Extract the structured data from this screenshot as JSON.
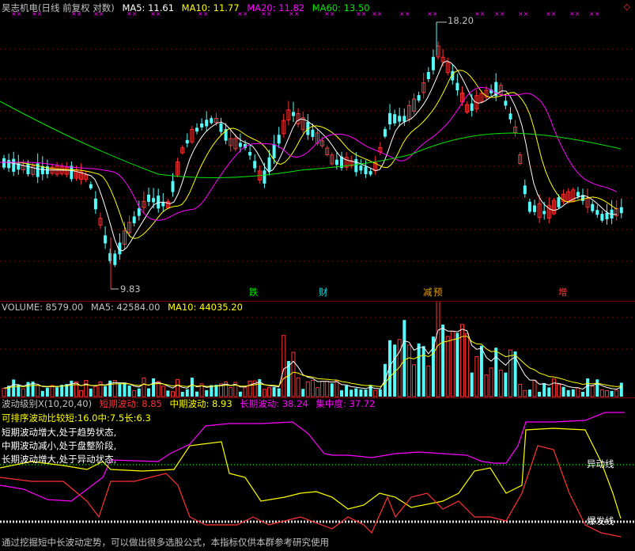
{
  "colors": {
    "background": "#000000",
    "up_candle": "#ff3232",
    "down_candle": "#54fcfc",
    "ma5": "#ffffff",
    "ma10": "#ffff00",
    "ma20": "#ff00ff",
    "ma60": "#00e600",
    "grid": "#800000"
  },
  "price_pane": {
    "title": "昊志机电(日线 前复权 对数)",
    "ma5_label": "MA5: 11.61",
    "ma10_label": "MA10: 11.77",
    "ma20_label": "MA20: 11.82",
    "ma60_label": "MA60: 13.50",
    "high_label": "18.20",
    "low_label": "9.83",
    "corner_icon": "diamond-icon",
    "event_markers": [
      "跌",
      "财",
      "减",
      "预",
      "增"
    ]
  },
  "volume_pane": {
    "volume_label": "VOLUME: 8579.00",
    "ma5_label": "MA5: 42584.00",
    "ma10_label": "MA10: 44035.20"
  },
  "indicator_pane": {
    "title": "波动级别X(10,20,40)",
    "short_label": "短期波动: 8.85",
    "mid_label": "中期波动: 8.93",
    "long_label": "长期波动: 38.24",
    "concentration_label": "集中度: 37.72",
    "sort_label": "可排序波动比较短:16.0中:7.5长:6.3",
    "state_lines": [
      "短期波动增大,处于趋势状态,",
      "中期波动减小,处于盘整阶段,",
      "长期波动增大,处于异动状态,"
    ],
    "line_label_anomaly": "异动线",
    "line_label_explosion": "爆发线",
    "footer": "通过挖掘短中长波动定势，可以做出很多选股公式，本指标仅供本群参考研究使用"
  }
}
